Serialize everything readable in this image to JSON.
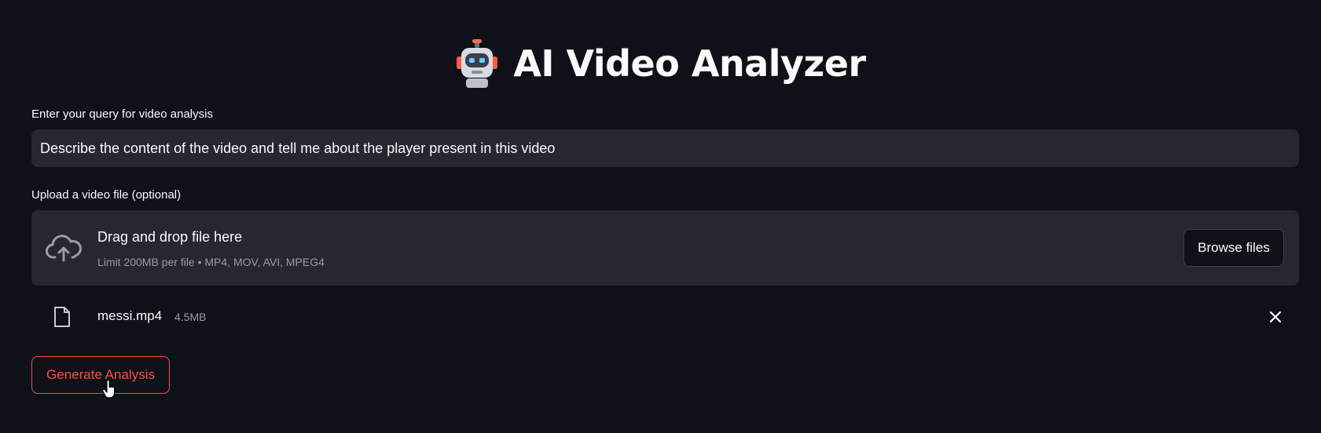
{
  "header": {
    "title": "AI Video Analyzer",
    "emoji_icon": "robot-face-icon"
  },
  "query": {
    "label": "Enter your query for video analysis",
    "value": "Describe the content of the video and tell me about the player present in this video"
  },
  "upload": {
    "label": "Upload a video file (optional)",
    "dropzone_title": "Drag and drop file here",
    "dropzone_limit": "Limit 200MB per file • MP4, MOV, AVI, MPEG4",
    "browse_label": "Browse files",
    "upload_icon": "cloud-upload-icon"
  },
  "uploaded_file": {
    "name": "messi.mp4",
    "size": "4.5MB",
    "file_icon": "file-icon",
    "remove_icon": "close-icon"
  },
  "actions": {
    "generate_label": "Generate Analysis"
  },
  "colors": {
    "background": "#0e1117",
    "surface": "#262730",
    "accent": "#ff4b4b",
    "text": "#fafafa",
    "muted_text": "#9a9ca6"
  }
}
